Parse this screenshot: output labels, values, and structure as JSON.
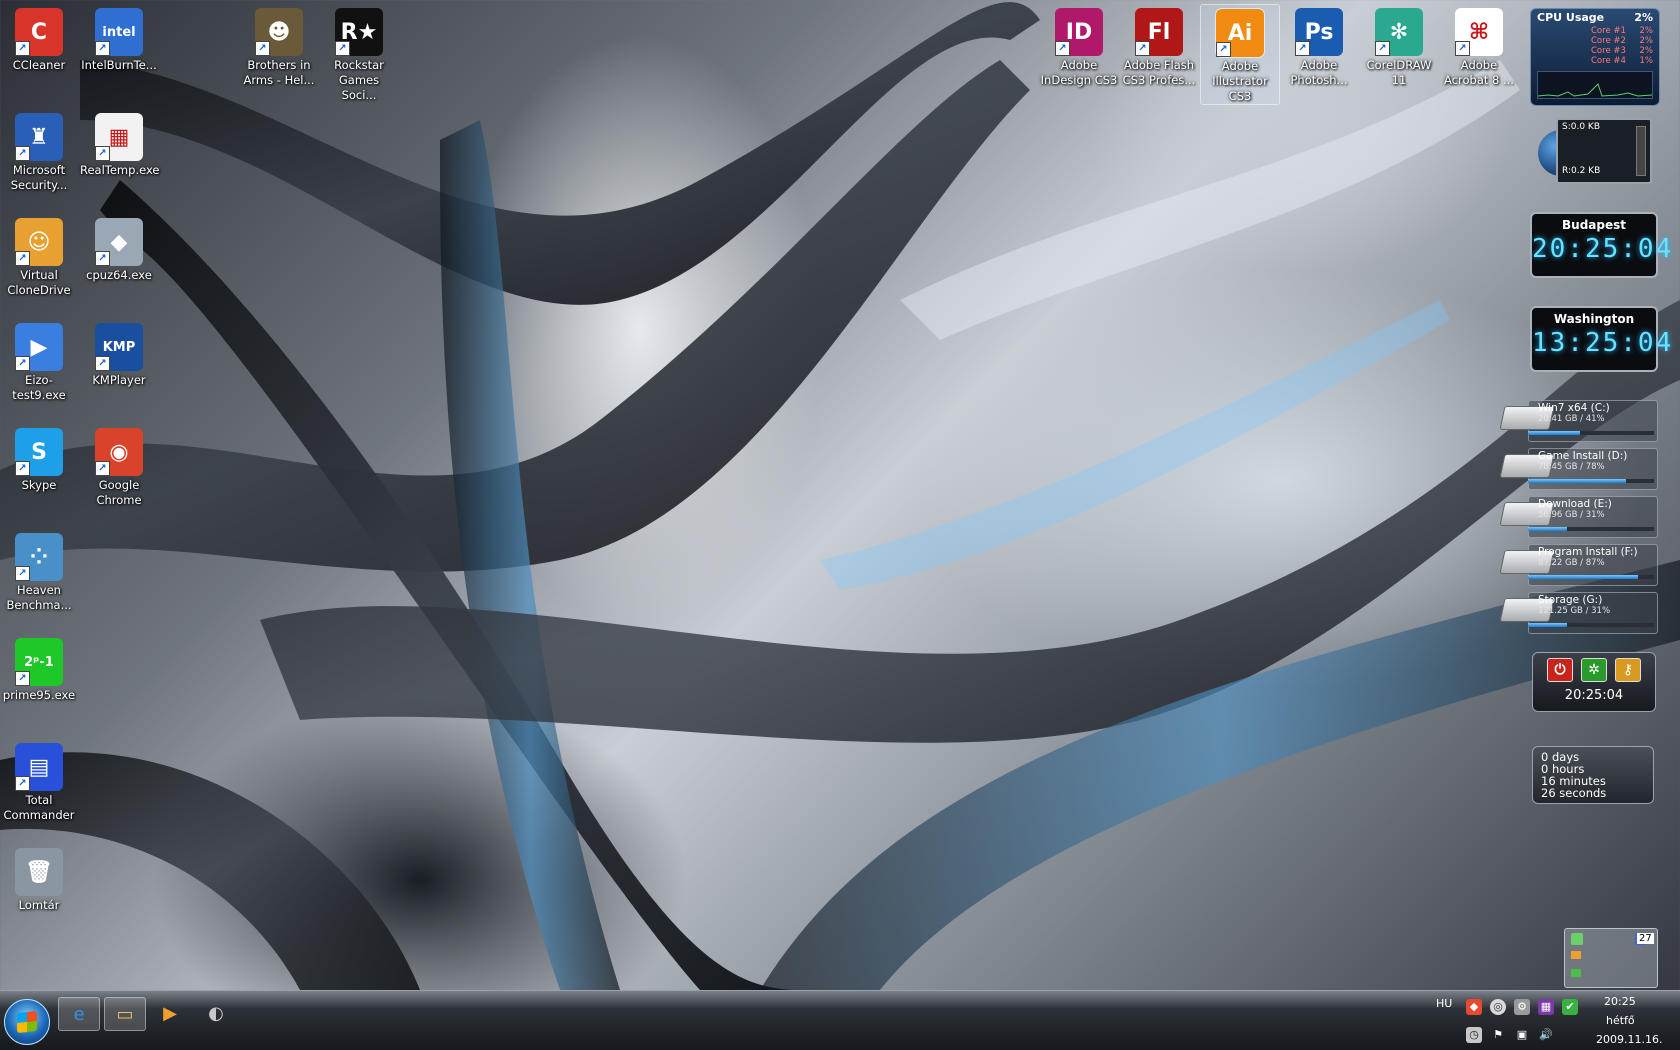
{
  "desktop_icons": [
    {
      "id": "ccleaner",
      "label": "CCleaner",
      "glyph": "C",
      "color": "#d9342a"
    },
    {
      "id": "intelburn",
      "label": "IntelBurnTe...",
      "glyph": "intel",
      "color": "#2f6fd1"
    },
    {
      "id": "brothers",
      "label": "Brothers in Arms - Hel...",
      "glyph": "☻",
      "color": "#6a5a3a"
    },
    {
      "id": "rockstar",
      "label": "Rockstar Games Soci...",
      "glyph": "R★",
      "color": "#111111"
    },
    {
      "id": "msse",
      "label": "Microsoft Security...",
      "glyph": "♜",
      "color": "#2a5fb8"
    },
    {
      "id": "realtemp",
      "label": "RealTemp.exe",
      "glyph": "▦",
      "color": "#f2f2f2"
    },
    {
      "id": "vcd",
      "label": "Virtual CloneDrive",
      "glyph": "☺",
      "color": "#e8a030"
    },
    {
      "id": "cpuz",
      "label": "cpuz64.exe",
      "glyph": "◆",
      "color": "#9aa7b4"
    },
    {
      "id": "eizo",
      "label": "Eizo-test9.exe",
      "glyph": "▶",
      "color": "#3a7fe0"
    },
    {
      "id": "kmp",
      "label": "KMPlayer",
      "glyph": "KMP",
      "color": "#1a4fa0"
    },
    {
      "id": "skype",
      "label": "Skype",
      "glyph": "S",
      "color": "#1ea0e8"
    },
    {
      "id": "chrome",
      "label": "Google Chrome",
      "glyph": "◉",
      "color": "#d9432c"
    },
    {
      "id": "heaven",
      "label": "Heaven Benchma...",
      "glyph": "⁘",
      "color": "#4a90c8"
    },
    {
      "id": "prime95",
      "label": "prime95.exe",
      "glyph": "2ᵖ-1",
      "color": "#1ec828"
    },
    {
      "id": "tc",
      "label": "Total Commander",
      "glyph": "▤",
      "color": "#2850d8"
    },
    {
      "id": "lomtar",
      "label": "Lomtár",
      "glyph": "🗑",
      "color": "#8a96a2"
    },
    {
      "id": "indesign",
      "label": "Adobe InDesign CS3",
      "glyph": "ID",
      "color": "#b0186a"
    },
    {
      "id": "flash",
      "label": "Adobe Flash CS3 Profes...",
      "glyph": "Fl",
      "color": "#b01818"
    },
    {
      "id": "illustrator",
      "label": "Adobe Illustrator CS3",
      "glyph": "Ai",
      "color": "#f08a10"
    },
    {
      "id": "photoshop",
      "label": "Adobe Photosh...",
      "glyph": "Ps",
      "color": "#1a5cb0"
    },
    {
      "id": "coreldraw",
      "label": "CorelDRAW 11",
      "glyph": "✻",
      "color": "#2aa890"
    },
    {
      "id": "acrobat",
      "label": "Adobe Acrobat 8 ...",
      "glyph": "⌘",
      "color": "#ffffff"
    }
  ],
  "cpu_gadget": {
    "title": "CPU Usage",
    "total": "2%",
    "cores": [
      {
        "name": "Core #1",
        "value": "2%"
      },
      {
        "name": "Core #2",
        "value": "2%"
      },
      {
        "name": "Core #3",
        "value": "2%"
      },
      {
        "name": "Core #4",
        "value": "1%"
      }
    ]
  },
  "net_gadget": {
    "sent": "S:0.0 KB",
    "received": "R:0.2 KB"
  },
  "clocks": [
    {
      "city": "Budapest",
      "time": "20:25:04"
    },
    {
      "city": "Washington",
      "time": "13:25:04"
    }
  ],
  "drives": [
    {
      "name": "Win7 x64 (C:)",
      "info": "20.41 GB / 41%",
      "percent": 41
    },
    {
      "name": "Game Install (D:)",
      "info": "78.45 GB / 78%",
      "percent": 78
    },
    {
      "name": "Download (E:)",
      "info": "56.96 GB / 31%",
      "percent": 31
    },
    {
      "name": "Program Install (F:)",
      "info": "87.22 GB / 87%",
      "percent": 87
    },
    {
      "name": "Storage (G:)",
      "info": "121.25 GB / 31%",
      "percent": 31
    }
  ],
  "shutdown_gadget": {
    "time": "20:25:04"
  },
  "uptime": {
    "days": "0 days",
    "hours": "0 hours",
    "minutes": "16 minutes",
    "seconds": "26 seconds"
  },
  "tray_popup": {
    "count": "27"
  },
  "taskbar": {
    "pinned": [
      {
        "id": "ie",
        "glyph": "e",
        "color": "#3a8fe8"
      },
      {
        "id": "explorer",
        "glyph": "▭",
        "color": "#e8c060"
      },
      {
        "id": "media",
        "glyph": "▶",
        "color": "#f0a030"
      },
      {
        "id": "misc",
        "glyph": "◐",
        "color": "#c8c8c8"
      }
    ],
    "language": "HU",
    "clock_time": "20:25",
    "clock_day": "hétfő",
    "clock_date": "2009.11.16."
  }
}
